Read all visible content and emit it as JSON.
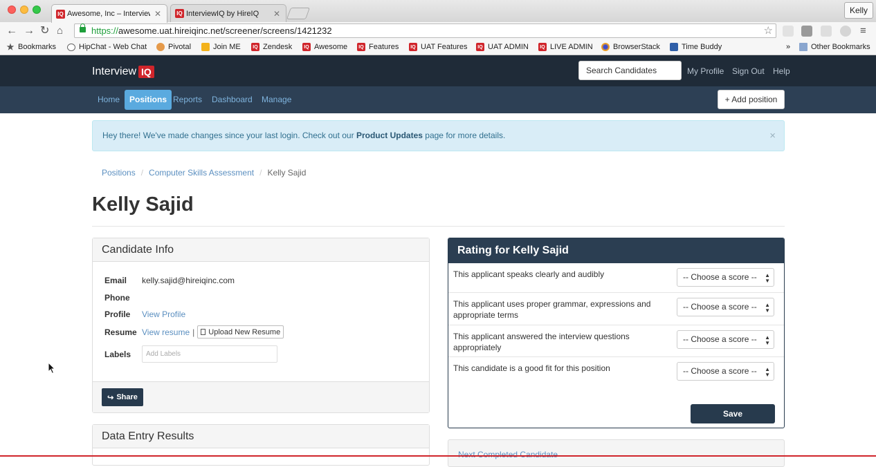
{
  "browser": {
    "tabs": [
      {
        "label": "Awesome, Inc – InterviewIQ",
        "favicon": "IQ"
      },
      {
        "label": "InterviewIQ by HireIQ",
        "favicon": "IQ"
      }
    ],
    "profile_name": "Kelly",
    "url_scheme": "https://",
    "url_rest": "awesome.uat.hireiqinc.net/screener/screens/1421232",
    "bookmarks": [
      {
        "label": "Bookmarks",
        "icon": "star-icon"
      },
      {
        "label": "HipChat - Web Chat",
        "icon": "hipchat-icon"
      },
      {
        "label": "Pivotal",
        "icon": "pivotal-icon"
      },
      {
        "label": "Join ME",
        "icon": "joinme-icon"
      },
      {
        "label": "Zendesk",
        "icon": "iq-icon"
      },
      {
        "label": "Awesome",
        "icon": "iq-icon"
      },
      {
        "label": "Features",
        "icon": "iq-icon"
      },
      {
        "label": "UAT Features",
        "icon": "iq-icon"
      },
      {
        "label": "UAT ADMIN",
        "icon": "iq-icon"
      },
      {
        "label": "LIVE ADMIN",
        "icon": "iq-icon"
      },
      {
        "label": "BrowserStack",
        "icon": "browserstack-icon"
      },
      {
        "label": "Time Buddy",
        "icon": "timebuddy-icon"
      }
    ],
    "overflow_label": "»",
    "other_bookmarks": "Other Bookmarks"
  },
  "header": {
    "logo_text": "Interview",
    "logo_badge": "IQ",
    "search_placeholder": "Search Candidates",
    "links": [
      "My Profile",
      "Sign Out",
      "Help"
    ]
  },
  "nav": {
    "items": [
      "Home",
      "Positions",
      "Reports",
      "Dashboard",
      "Manage"
    ],
    "active": "Positions",
    "add_position": "+ Add position"
  },
  "alert": {
    "prefix": "Hey there! We've made changes since your last login. Check out our ",
    "bold": "Product Updates",
    "suffix": " page for more details.",
    "close": "×"
  },
  "breadcrumb": {
    "items": [
      "Positions",
      "Computer Skills Assessment"
    ],
    "current": "Kelly Sajid",
    "separator": "/"
  },
  "page_title": "Kelly Sajid",
  "candidate_info": {
    "heading": "Candidate Info",
    "email_label": "Email",
    "email_value": "kelly.sajid@hireiqinc.com",
    "phone_label": "Phone",
    "phone_value": "",
    "profile_label": "Profile",
    "profile_link": "View Profile",
    "resume_label": "Resume",
    "resume_link": "View resume",
    "resume_separator": "|",
    "upload_button": "Upload New Resume",
    "labels_label": "Labels",
    "labels_placeholder": "Add Labels",
    "share_button": "Share"
  },
  "data_entry": {
    "heading": "Data Entry Results"
  },
  "rating": {
    "heading": "Rating for Kelly Sajid",
    "criteria": [
      {
        "text": "This applicant speaks clearly and audibly",
        "score": "-- Choose a score --"
      },
      {
        "text": "This applicant uses proper grammar, expressions and appropriate terms",
        "score": "-- Choose a score --"
      },
      {
        "text": "This applicant answered the interview questions appropriately",
        "score": "-- Choose a score --"
      },
      {
        "text": "This candidate is a good fit for this position",
        "score": "-- Choose a score --"
      }
    ],
    "save_button": "Save"
  },
  "next_candidate": "Next Completed Candidate",
  "colors": {
    "header_bg": "#1f2b38",
    "subnav_bg": "#2d4055",
    "active_nav": "#5aaadf",
    "brand_red": "#d0252b",
    "primary_button": "#273a4d",
    "link": "#5b8fc0"
  }
}
